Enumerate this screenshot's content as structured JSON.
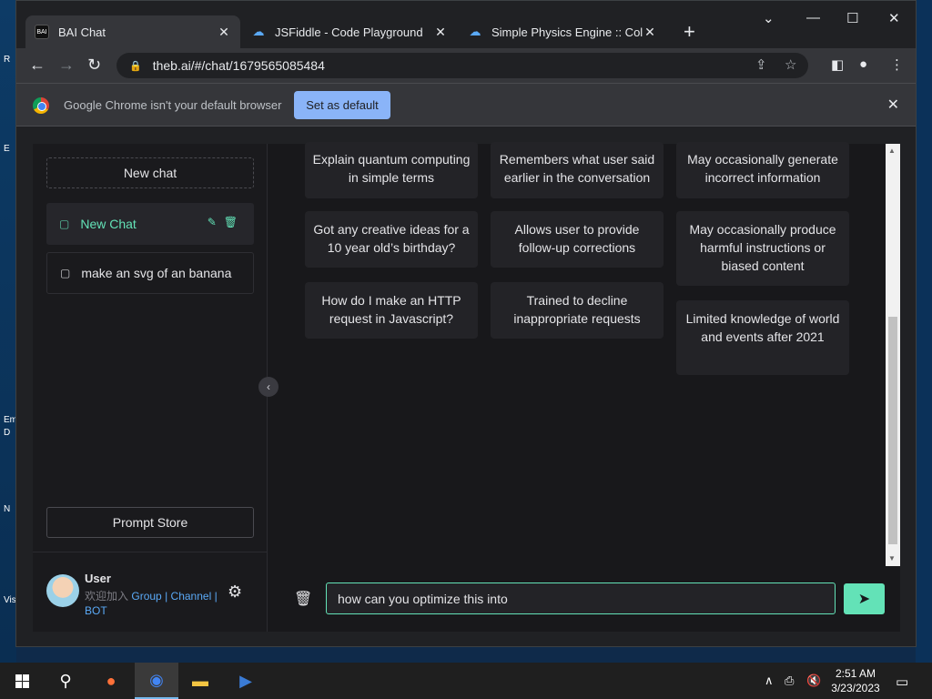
{
  "desktop": {
    "edge_labels": [
      "R",
      "E",
      "Em",
      "D",
      "N",
      "Vis"
    ]
  },
  "browser": {
    "tabs": [
      {
        "title": "BAI Chat",
        "favicon_text": "BAI"
      },
      {
        "title": "JSFiddle - Code Playground"
      },
      {
        "title": "Simple Physics Engine :: Collision"
      }
    ],
    "url": "theb.ai/#/chat/1679565085484",
    "infobar": {
      "message": "Google Chrome isn't your default browser",
      "button": "Set as default"
    }
  },
  "sidebar": {
    "new_chat_label": "New chat",
    "chats": [
      {
        "label": "New Chat",
        "active": true
      },
      {
        "label": "make an svg of an banana",
        "active": false
      }
    ],
    "prompt_store_label": "Prompt Store",
    "user": {
      "name": "User",
      "join_text": "欢迎加入",
      "link_group": "Group",
      "sep": "|",
      "link_channel": "Channel",
      "link_bot": "BOT"
    }
  },
  "main": {
    "cards": [
      [
        "Explain quantum computing in simple terms",
        "Got any creative ideas for a 10 year old’s birthday?",
        "How do I make an HTTP request in Javascript?"
      ],
      [
        "Remembers what user said earlier in the conversation",
        "Allows user to provide follow-up corrections",
        "Trained to decline inappropriate requests"
      ],
      [
        "May occasionally generate incorrect information",
        "May occasionally produce harmful instructions or biased content",
        "Limited knowledge of world and events after 2021"
      ]
    ],
    "input_value": "how can you optimize this into"
  },
  "taskbar": {
    "time": "2:51 AM",
    "date": "3/23/2023"
  },
  "colors": {
    "accent": "#63e2b7",
    "link": "#5aa9f6",
    "chrome_button": "#8ab4f8"
  }
}
